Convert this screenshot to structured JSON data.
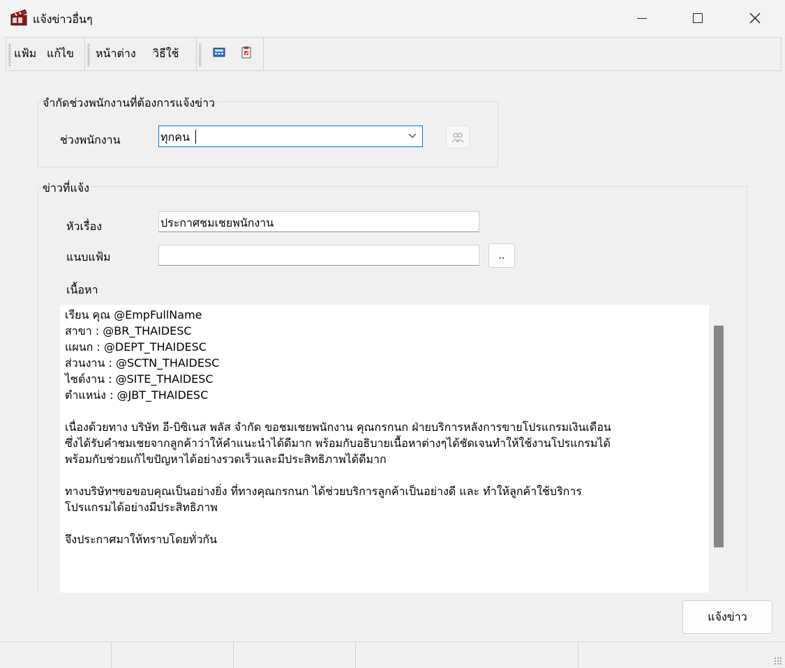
{
  "window": {
    "title": "แจ้งข่าวอื่นๆ",
    "app_icon": "film-clapper-icon"
  },
  "menu": {
    "items": [
      "แฟ้ม",
      "แก้ไข",
      "หน้าต่าง",
      "วิธีใช้"
    ],
    "toolbar_icons": [
      "calculator-icon",
      "clipboard-icon"
    ]
  },
  "employee_range_group": {
    "legend": "จำกัดช่วงพนักงานที่ต้องการแจ้งข่าว",
    "range_label": "ช่วงพนักงาน",
    "range_value": "ทุกคน",
    "picker_icon": "people-search-icon"
  },
  "news_group": {
    "legend": "ข่าวที่แจ้ง",
    "subject_label": "หัวเรื่อง",
    "subject_value": "ประกาศชมเชยพนักงาน",
    "attach_label": "แนบแฟ้ม",
    "attach_value": "",
    "browse_label": "..",
    "content_label": "เนื้อหา",
    "content_lines": [
      "เรียน คุณ @EmpFullName",
      "สาขา : @BR_THAIDESC",
      "แผนก : @DEPT_THAIDESC",
      "ส่วนงาน : @SCTN_THAIDESC",
      "ไซต์งาน : @SITE_THAIDESC",
      "ตำแหน่ง : @JBT_THAIDESC",
      "",
      "เนื่องด้วยทาง บริษัท อี-บิซิเนส พลัส จำกัด ขอชมเชยพนักงาน คุณกรกนก ฝ่ายบริการหลังการขายโปรแกรมเงินเดือน",
      "ซึ่งได้รับคำชมเชยจากลูกค้าว่าให้คำแนะนำได้ดีมาก พร้อมกับอธิบายเนื้อหาต่างๆได้ชัดเจนทำให้ใช้งานโปรแกรมได้",
      "พร้อมกับช่วยแก้ไขปัญหาได้อย่างรวดเร็วและมีประสิทธิภาพได้ดีมาก",
      "",
      "ทางบริษัทฯขอขอบคุณเป็นอย่างยิ่ง ที่ทางคุณกรกนก ได้ช่วยบริการลูกค้าเป็นอย่างดี และ ทำให้ลูกค้าใช้บริการ",
      "โปรแกรมได้อย่างมีประสิทธิภาพ",
      "",
      "จึงประกาศมาให้ทราบโดยทั่วกัน"
    ]
  },
  "actions": {
    "notify_label": "แจ้งข่าว"
  }
}
